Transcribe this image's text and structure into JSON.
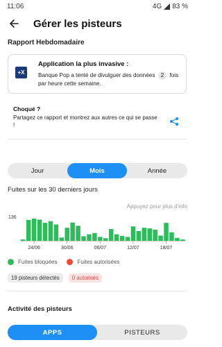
{
  "status_bar": {
    "time": "11:06",
    "network": "4G",
    "battery": "83 %"
  },
  "header": {
    "title": "Gérer les pisteurs"
  },
  "weekly_report": {
    "section_title": "Rapport Hebdomadaire",
    "card_heading": "Application la plus invasive :",
    "logo_text": "+X",
    "text_before": "Banque Pop a tenté de divulguer des données",
    "count": "2",
    "text_after": "fois par heure cette semaine."
  },
  "share": {
    "title": "Choqué ?",
    "text": "Partagez ce rapport et montrez aux autres ce qui se passe !"
  },
  "period_toggle": {
    "day": "Jour",
    "month": "Mois",
    "year": "Année",
    "selected": "Mois"
  },
  "leaks": {
    "title": "Fuites sur les 30 derniers jours",
    "hint": "Appuyez pour plus d'info"
  },
  "legend": {
    "blocked": "Fuites bloquées",
    "allowed": "Fuites autorisées"
  },
  "badges": {
    "detected": "19 pisteurs détectés",
    "authorized": "0 autorisés"
  },
  "activity": {
    "title": "Activité des pisteurs"
  },
  "tracker_toggle": {
    "apps": "APPS",
    "trackers": "PISTEURS",
    "selected": "APPS"
  },
  "colors": {
    "accent": "#1e8ff5",
    "blocked": "#2bbd5a",
    "allowed": "#ee4a35"
  },
  "chart_data": {
    "type": "bar",
    "ylabel": "",
    "y_tick_labels": [
      "136"
    ],
    "ylim": [
      0,
      136
    ],
    "x_tick_labels": [
      "24/06",
      "30/06",
      "06/07",
      "12/07",
      "18/07"
    ],
    "series": [
      {
        "values": [
          8,
          128,
          136,
          130,
          110,
          120,
          100,
          20,
          80,
          112,
          92,
          28,
          40,
          48,
          24,
          16,
          72,
          40,
          30,
          24,
          88,
          60,
          80,
          76,
          68,
          32,
          110,
          52,
          18,
          8
        ]
      }
    ]
  }
}
